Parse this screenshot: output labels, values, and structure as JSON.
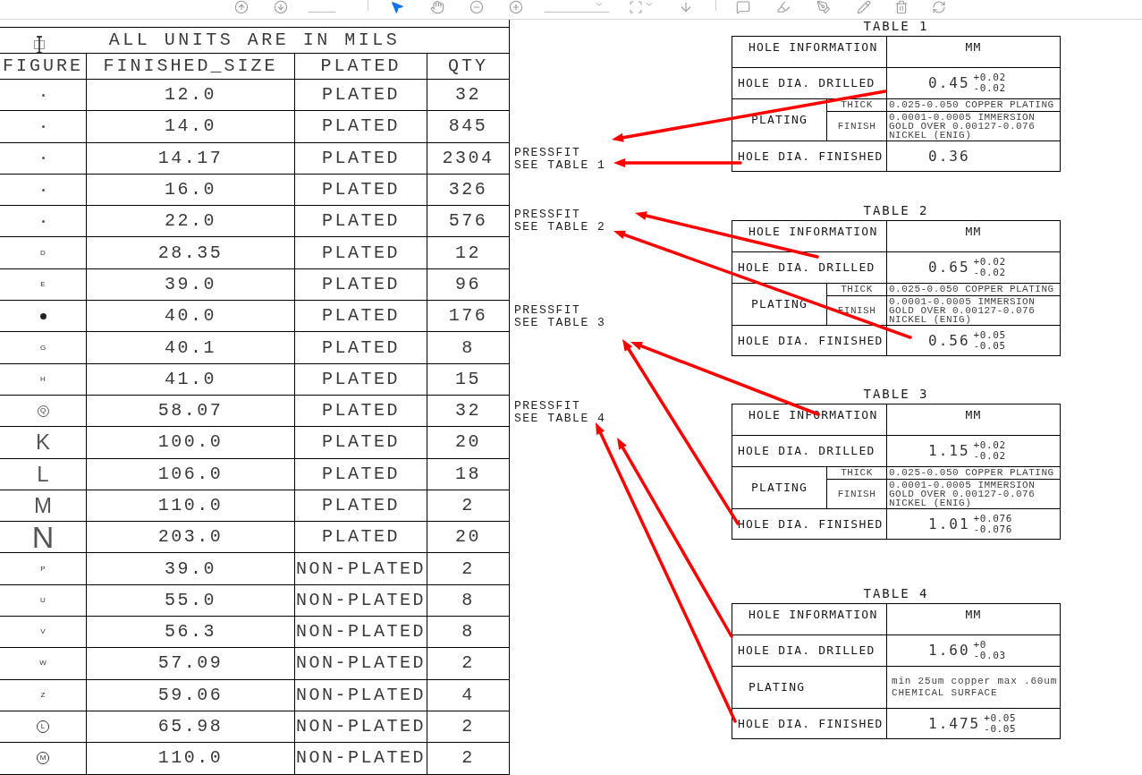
{
  "toolbar": {
    "tools": [
      {
        "kind": "pointer",
        "selected": true
      },
      {
        "kind": "hand",
        "selected": false
      }
    ]
  },
  "drill_table": {
    "title": "ALL UNITS ARE IN MILS",
    "columns": [
      "FIGURE",
      "FINISHED_SIZE",
      "PLATED",
      "QTY"
    ],
    "rows": [
      {
        "figure": {
          "kind": "dot"
        },
        "size": "12.0",
        "plating": "PLATED",
        "qty": "32"
      },
      {
        "figure": {
          "kind": "dot"
        },
        "size": "14.0",
        "plating": "PLATED",
        "qty": "845"
      },
      {
        "figure": {
          "kind": "dot"
        },
        "size": "14.17",
        "plating": "PLATED",
        "qty": "2304"
      },
      {
        "figure": {
          "kind": "dot"
        },
        "size": "16.0",
        "plating": "PLATED",
        "qty": "326"
      },
      {
        "figure": {
          "kind": "dot"
        },
        "size": "22.0",
        "plating": "PLATED",
        "qty": "576"
      },
      {
        "figure": {
          "kind": "mark",
          "text": "D"
        },
        "size": "28.35",
        "plating": "PLATED",
        "qty": "12"
      },
      {
        "figure": {
          "kind": "mark",
          "text": "E"
        },
        "size": "39.0",
        "plating": "PLATED",
        "qty": "96"
      },
      {
        "figure": {
          "kind": "disc"
        },
        "size": "40.0",
        "plating": "PLATED",
        "qty": "176"
      },
      {
        "figure": {
          "kind": "mark",
          "text": "G"
        },
        "size": "40.1",
        "plating": "PLATED",
        "qty": "8"
      },
      {
        "figure": {
          "kind": "mark",
          "text": "H"
        },
        "size": "41.0",
        "plating": "PLATED",
        "qty": "15"
      },
      {
        "figure": {
          "kind": "ring",
          "text": "Q"
        },
        "size": "58.07",
        "plating": "PLATED",
        "qty": "32"
      },
      {
        "figure": {
          "kind": "letter",
          "text": "K"
        },
        "size": "100.0",
        "plating": "PLATED",
        "qty": "20"
      },
      {
        "figure": {
          "kind": "letter",
          "text": "L"
        },
        "size": "106.0",
        "plating": "PLATED",
        "qty": "18"
      },
      {
        "figure": {
          "kind": "letter",
          "text": "M"
        },
        "size": "110.0",
        "plating": "PLATED",
        "qty": "2"
      },
      {
        "figure": {
          "kind": "tall",
          "text": "N"
        },
        "size": "203.0",
        "plating": "PLATED",
        "qty": "20"
      },
      {
        "figure": {
          "kind": "mark",
          "text": "P"
        },
        "size": "39.0",
        "plating": "NON-PLATED",
        "qty": "2"
      },
      {
        "figure": {
          "kind": "mark",
          "text": "U"
        },
        "size": "55.0",
        "plating": "NON-PLATED",
        "qty": "8"
      },
      {
        "figure": {
          "kind": "mark",
          "text": "V"
        },
        "size": "56.3",
        "plating": "NON-PLATED",
        "qty": "8"
      },
      {
        "figure": {
          "kind": "mark",
          "text": "W"
        },
        "size": "57.09",
        "plating": "NON-PLATED",
        "qty": "2"
      },
      {
        "figure": {
          "kind": "mark",
          "text": "Z"
        },
        "size": "59.06",
        "plating": "NON-PLATED",
        "qty": "4"
      },
      {
        "figure": {
          "kind": "circled",
          "text": "L"
        },
        "size": "65.98",
        "plating": "NON-PLATED",
        "qty": "2"
      },
      {
        "figure": {
          "kind": "circled",
          "text": "M"
        },
        "size": "110.0",
        "plating": "NON-PLATED",
        "qty": "2"
      }
    ]
  },
  "notes": [
    {
      "lines": [
        "PRESSFIT",
        "SEE TABLE 1"
      ]
    },
    {
      "lines": [
        "PRESSFIT",
        "SEE TABLE 2"
      ]
    },
    {
      "lines": [
        "PRESSFIT",
        "SEE TABLE 3"
      ]
    },
    {
      "lines": [
        "PRESSFIT",
        "SEE TABLE 4"
      ]
    }
  ],
  "hole_tables": [
    {
      "title": "TABLE 1",
      "header": [
        "HOLE INFORMATION",
        "MM"
      ],
      "drilled": {
        "label": "HOLE DIA. DRILLED",
        "value": "0.45",
        "plus": "+0.02",
        "minus": "-0.02"
      },
      "plating": {
        "kind": "split",
        "label": "PLATING",
        "thick_label": "THICK",
        "thick": "0.025-0.050 COPPER PLATING",
        "finish_label": "FINISH",
        "finish": [
          "0.0001-0.0005 IMMERSION",
          "GOLD OVER 0.00127-0.076",
          "NICKEL (ENIG)"
        ]
      },
      "finished": {
        "label": "HOLE DIA. FINISHED",
        "value": "0.36"
      }
    },
    {
      "title": "TABLE 2",
      "header": [
        "HOLE INFORMATION",
        "MM"
      ],
      "drilled": {
        "label": "HOLE DIA. DRILLED",
        "value": "0.65",
        "plus": "+0.02",
        "minus": "-0.02"
      },
      "plating": {
        "kind": "split",
        "label": "PLATING",
        "thick_label": "THICK",
        "thick": "0.025-0.050 COPPER PLATING",
        "finish_label": "FINISH",
        "finish": [
          "0.0001-0.0005 IMMERSION",
          "GOLD OVER 0.00127-0.076",
          "NICKEL (ENIG)"
        ]
      },
      "finished": {
        "label": "HOLE DIA. FINISHED",
        "value": "0.56",
        "plus": "+0.05",
        "minus": "-0.05"
      }
    },
    {
      "title": "TABLE 3",
      "header": [
        "HOLE INFORMATION",
        "MM"
      ],
      "drilled": {
        "label": "HOLE DIA. DRILLED",
        "value": "1.15",
        "plus": "+0.02",
        "minus": "-0.02"
      },
      "plating": {
        "kind": "split",
        "label": "PLATING",
        "thick_label": "THICK",
        "thick": "0.025-0.050 COPPER PLATING",
        "finish_label": "FINISH",
        "finish": [
          "0.0001-0.0005 IMMERSION",
          "GOLD OVER 0.00127-0.076",
          "NICKEL (ENIG)"
        ]
      },
      "finished": {
        "label": "HOLE DIA. FINISHED",
        "value": "1.01",
        "plus": "+0.076",
        "minus": "-0.076"
      }
    },
    {
      "title": "TABLE 4",
      "header": [
        "HOLE INFORMATION",
        "MM"
      ],
      "drilled": {
        "label": "HOLE DIA. DRILLED",
        "value": "1.60",
        "plus": "+0",
        "minus": "-0.03"
      },
      "plating": {
        "kind": "plain",
        "label": "PLATING",
        "lines": [
          "min 25um copper max .60um",
          "CHEMICAL SURFACE"
        ]
      },
      "finished": {
        "label": "HOLE DIA. FINISHED",
        "value": "1.475",
        "plus": "+0.05",
        "minus": "-0.05"
      }
    }
  ]
}
